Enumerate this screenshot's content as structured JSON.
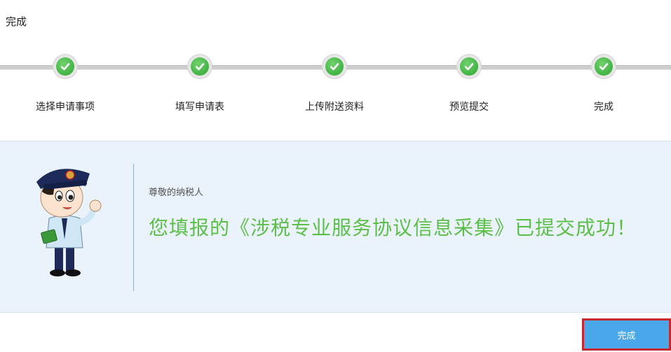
{
  "page": {
    "title": "完成"
  },
  "steps": [
    {
      "label": "选择申请事项",
      "icon": "check-circle-icon",
      "status": "done"
    },
    {
      "label": "填写申请表",
      "icon": "check-circle-icon",
      "status": "done"
    },
    {
      "label": "上传附送资料",
      "icon": "check-circle-icon",
      "status": "done"
    },
    {
      "label": "预览提交",
      "icon": "check-circle-icon",
      "status": "done"
    },
    {
      "label": "完成",
      "icon": "check-circle-icon",
      "status": "done"
    }
  ],
  "result": {
    "greeting": "尊敬的纳税人",
    "message": "您填报的《涉税专业服务协议信息采集》已提交成功！",
    "mascot": "tax-officer-mascot"
  },
  "footer": {
    "finish_label": "完成"
  },
  "colors": {
    "accent_green": "#5cbf4a",
    "check_green": "#2fa62f",
    "panel_bg": "#eaf3fb",
    "button_blue": "#4aa8ea",
    "highlight_red": "#c9272d"
  }
}
